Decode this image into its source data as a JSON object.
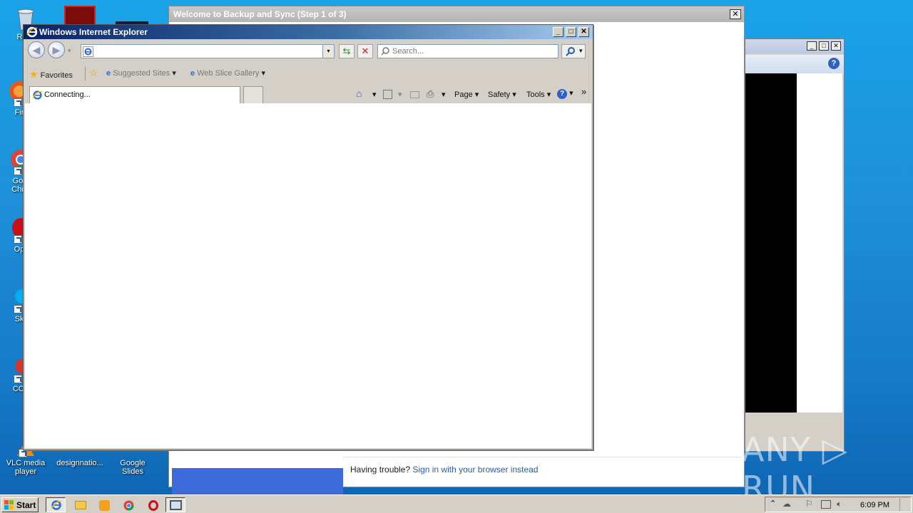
{
  "desktop": {
    "icons": [
      {
        "label": "Recy"
      },
      {
        "label": "Fir"
      },
      {
        "label": "Go Chr"
      },
      {
        "label": "Op"
      },
      {
        "label": "Sk"
      },
      {
        "label": "CCl"
      },
      {
        "label": "VLC media player"
      },
      {
        "label": "designnatio..."
      },
      {
        "label": "Google Slides"
      }
    ]
  },
  "backup_window": {
    "title": "Welcome to Backup and Sync (Step 1 of 3)",
    "close_glyph": "✕",
    "trouble_text": "Having trouble?",
    "trouble_link": "Sign in with your browser instead"
  },
  "right_window": {
    "minimize_glyph": "_",
    "maximize_glyph": "□",
    "close_glyph": "✕",
    "help_glyph": "?"
  },
  "ie": {
    "title": "Windows Internet Explorer",
    "minimize_glyph": "_",
    "maximize_glyph": "□",
    "close_glyph": "✕",
    "address_value": "",
    "search_placeholder": "Search...",
    "favorites_label": "Favorites",
    "suggested_sites_label": "Suggested Sites",
    "web_slice_label": "Web Slice Gallery",
    "tab_label": "Connecting...",
    "commands": {
      "page": "Page",
      "safety": "Safety",
      "tools": "Tools"
    },
    "chevron": "»",
    "dropdown_arrow": "▾"
  },
  "taskbar": {
    "start_label": "Start",
    "clock": "6:09 PM"
  },
  "watermark": "ANY ▷ RUN"
}
